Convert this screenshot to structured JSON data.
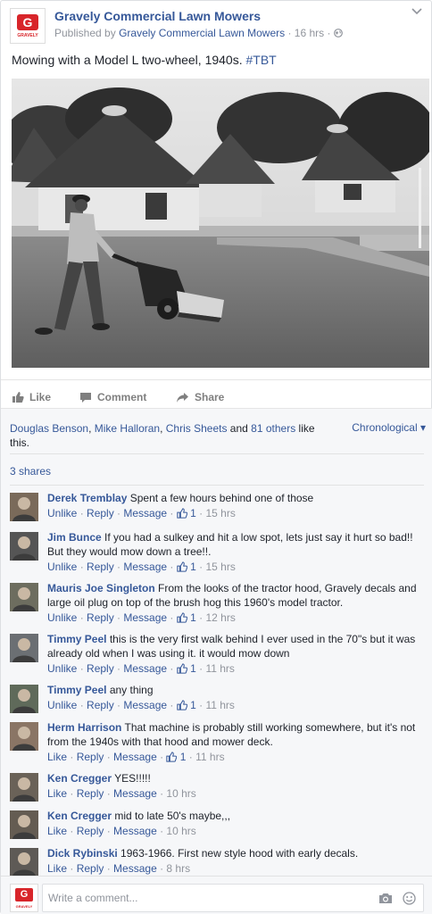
{
  "post": {
    "page_name": "Gravely Commercial Lawn Mowers",
    "published_prefix": "Published by",
    "published_by": "Gravely Commercial Lawn Mowers",
    "time": "16 hrs",
    "dot": "·",
    "caption_text": "Mowing with a Model L two-wheel, 1940s. ",
    "caption_hashtag": "#TBT",
    "logo_text": "G",
    "logo_word": "GRAVELY"
  },
  "actions": {
    "like": "Like",
    "comment": "Comment",
    "share": "Share"
  },
  "likes": {
    "name1": "Douglas Benson",
    "sep1": ", ",
    "name2": "Mike Halloran",
    "sep2": ", ",
    "name3": "Chris Sheets",
    "and": " and ",
    "others": "81 others",
    "tail": " like this.",
    "sort": "Chronological ▾"
  },
  "shares": "3 shares",
  "comments": [
    {
      "name": "Derek Tremblay",
      "text": "Spent a few hours behind one of those",
      "a1": "Unlike",
      "a2": "Reply",
      "a3": "Message",
      "likes": "1",
      "time": "15 hrs"
    },
    {
      "name": "Jim Bunce",
      "text": "If you had a sulkey and hit a low spot, lets just say it hurt so bad!! But they would mow down a tree!!.",
      "a1": "Unlike",
      "a2": "Reply",
      "a3": "Message",
      "likes": "1",
      "time": "15 hrs"
    },
    {
      "name": "Mauris Joe Singleton",
      "text": "From the looks of the tractor hood, Gravely decals and large oil plug on top of the brush hog this 1960's model tractor.",
      "a1": "Unlike",
      "a2": "Reply",
      "a3": "Message",
      "likes": "1",
      "time": "12 hrs"
    },
    {
      "name": "Timmy Peel",
      "text": "this is the very first walk behind I ever used in the 70\"s but it was already old when I was using it. it would mow down",
      "a1": "Unlike",
      "a2": "Reply",
      "a3": "Message",
      "likes": "1",
      "time": "11 hrs"
    },
    {
      "name": "Timmy Peel",
      "text": "any thing",
      "a1": "Unlike",
      "a2": "Reply",
      "a3": "Message",
      "likes": "1",
      "time": "11 hrs"
    },
    {
      "name": "Herm Harrison",
      "text": "That machine is probably still working somewhere, but it's not from the 1940s with that hood and mower deck.",
      "a1": "Like",
      "a2": "Reply",
      "a3": "Message",
      "likes": "1",
      "time": "11 hrs"
    },
    {
      "name": "Ken Cregger",
      "text": "YES!!!!!",
      "a1": "Like",
      "a2": "Reply",
      "a3": "Message",
      "likes": "",
      "time": "10 hrs"
    },
    {
      "name": "Ken Cregger",
      "text": "mid to late 50's maybe,,,",
      "a1": "Like",
      "a2": "Reply",
      "a3": "Message",
      "likes": "",
      "time": "10 hrs"
    },
    {
      "name": "Dick Rybinski",
      "text": "1963-1966. First new style hood with early decals.",
      "a1": "Like",
      "a2": "Reply",
      "a3": "Message",
      "likes": "",
      "time": "8 hrs"
    }
  ],
  "composer": {
    "placeholder": "Write a comment..."
  },
  "colors": {
    "link": "#365899",
    "muted": "#90949c",
    "brand": "#d8252a"
  },
  "icons": [
    "chevron-down-icon",
    "globe-icon",
    "like-thumb-icon",
    "comment-bubble-icon",
    "share-arrow-icon",
    "camera-icon",
    "emoji-icon"
  ]
}
